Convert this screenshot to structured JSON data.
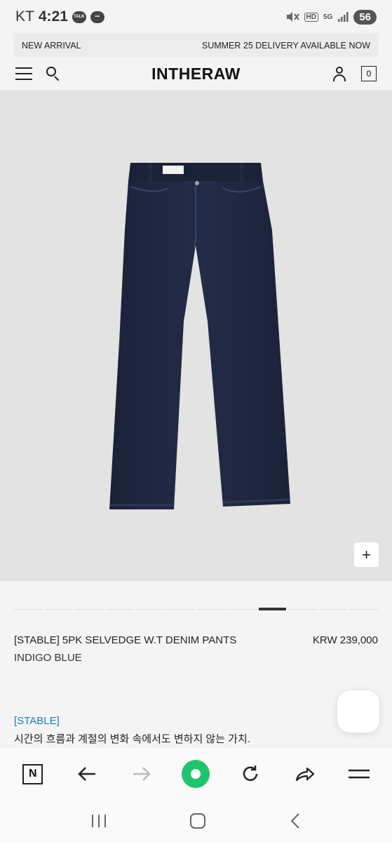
{
  "status_bar": {
    "carrier": "KT",
    "time": "4:21",
    "talk_badge": "TALK",
    "hd_label": "HD",
    "network": "5G",
    "battery": "56"
  },
  "announcement": {
    "left": "NEW ARRIVAL",
    "right": "SUMMER 25 DELIVERY AVAILABLE NOW"
  },
  "header": {
    "logo": "INTHERAW",
    "cart_count": "0"
  },
  "gallery": {
    "zoom_label": "+",
    "page_count": 12,
    "active_page": 9
  },
  "product": {
    "name": "[STABLE] 5PK SELVEDGE W.T DENIM PANTS",
    "price": "KRW 239,000",
    "color": "INDIGO BLUE"
  },
  "description": {
    "tag": "[STABLE]",
    "line1": "시간의 흐름과 계절의 변화 속에서도 변하지 않는 가치."
  },
  "browser_bar": {
    "n_label": "N"
  },
  "colors": {
    "denim": "#1d2540",
    "accent_link": "#1f7ab8",
    "home_green": "#1ec46d"
  }
}
